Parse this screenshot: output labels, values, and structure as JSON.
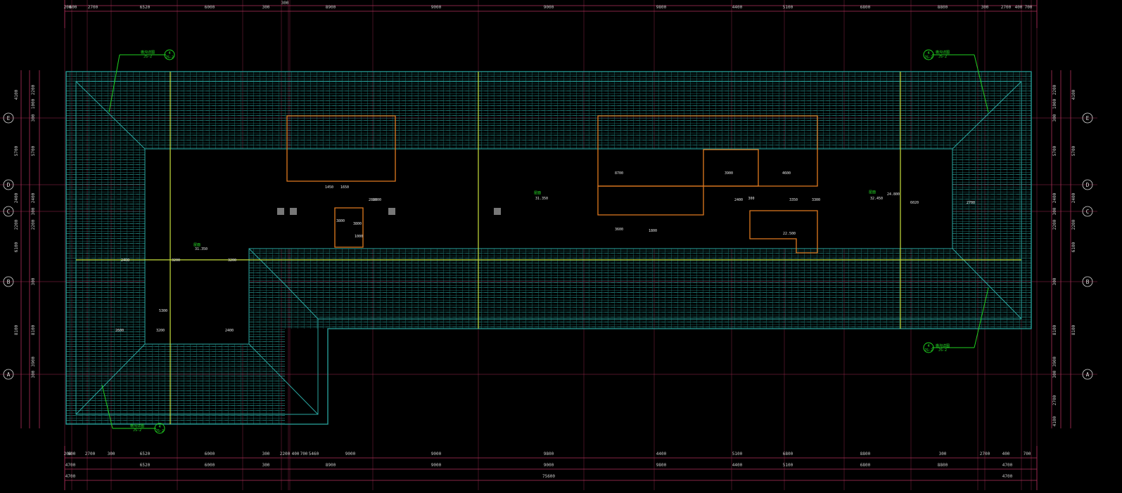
{
  "drawing": {
    "top_dims_row1": [
      "200",
      "600",
      "2700",
      "6520",
      "6000",
      "300",
      "8900",
      "9000",
      "9000",
      "9800",
      "4400",
      "5100",
      "6800",
      "8800",
      "300",
      "2700",
      "400",
      "700"
    ],
    "top_dims_row2": [
      "300"
    ],
    "bottom_dims_row1": [
      "200",
      "600",
      "2700",
      "300",
      "6520",
      "6000",
      "300",
      "2200",
      "400",
      "700",
      "5460",
      "9000",
      "9000",
      "9800",
      "4400",
      "5100",
      "6800",
      "8800",
      "300",
      "2700",
      "400",
      "700"
    ],
    "bottom_dims_row2": [
      "4700",
      "6520",
      "6000",
      "300",
      "8900",
      "9000",
      "9000",
      "9800",
      "4400",
      "5100",
      "6800",
      "8800",
      "4700"
    ],
    "bottom_dims_row3": [
      "4700",
      "75600",
      "4700"
    ],
    "axis_labels": [
      "E",
      "D",
      "C",
      "B",
      "A"
    ],
    "left_dims_outer": [
      "4100",
      "5700",
      "2400",
      "2200",
      "6100",
      "8100"
    ],
    "left_dims_inner": [
      "2200",
      "1000",
      "300",
      "5700",
      "2400",
      "300",
      "2200",
      "300",
      "8100",
      "3900",
      "300"
    ],
    "right_dims_outer": [
      "4100",
      "5700",
      "2400",
      "2200",
      "6100",
      "8100"
    ],
    "right_dims_inner": [
      "2200",
      "1000",
      "300",
      "5700",
      "2400",
      "300",
      "2200",
      "300",
      "8100",
      "3900",
      "300",
      "2700",
      "4100"
    ],
    "callouts": [
      {
        "text": "檐沟详图",
        "ref": "4",
        "sheet": "JS-2"
      },
      {
        "text": "檐沟详图",
        "ref": "4",
        "sheet": "JS-2"
      },
      {
        "text": "檐沟详图",
        "ref": "4",
        "sheet": "JS-2"
      },
      {
        "text": "檐沟详图",
        "ref": "4",
        "sheet": "JS-2"
      }
    ],
    "interior_dims": [
      "1450",
      "1650",
      "2800",
      "3800",
      "3800",
      "1000",
      "2800",
      "3600",
      "1800",
      "8700",
      "3900",
      "4600",
      "300",
      "3350",
      "3300",
      "6020",
      "2700",
      "3200",
      "3200",
      "2400",
      "3200",
      "2600",
      "5300",
      "2400",
      "2400"
    ],
    "roof_labels": [
      "屋面",
      "屋面",
      "屋面"
    ],
    "level_marks": [
      "31.350",
      "31.350",
      "32.450",
      "22.500",
      "24.800"
    ],
    "colors": {
      "background": "#000000",
      "dimension": "#b0305a",
      "roof_tile": "#2aa6a0",
      "wall": "#e07a20",
      "annotation": "#1fd01f"
    }
  }
}
